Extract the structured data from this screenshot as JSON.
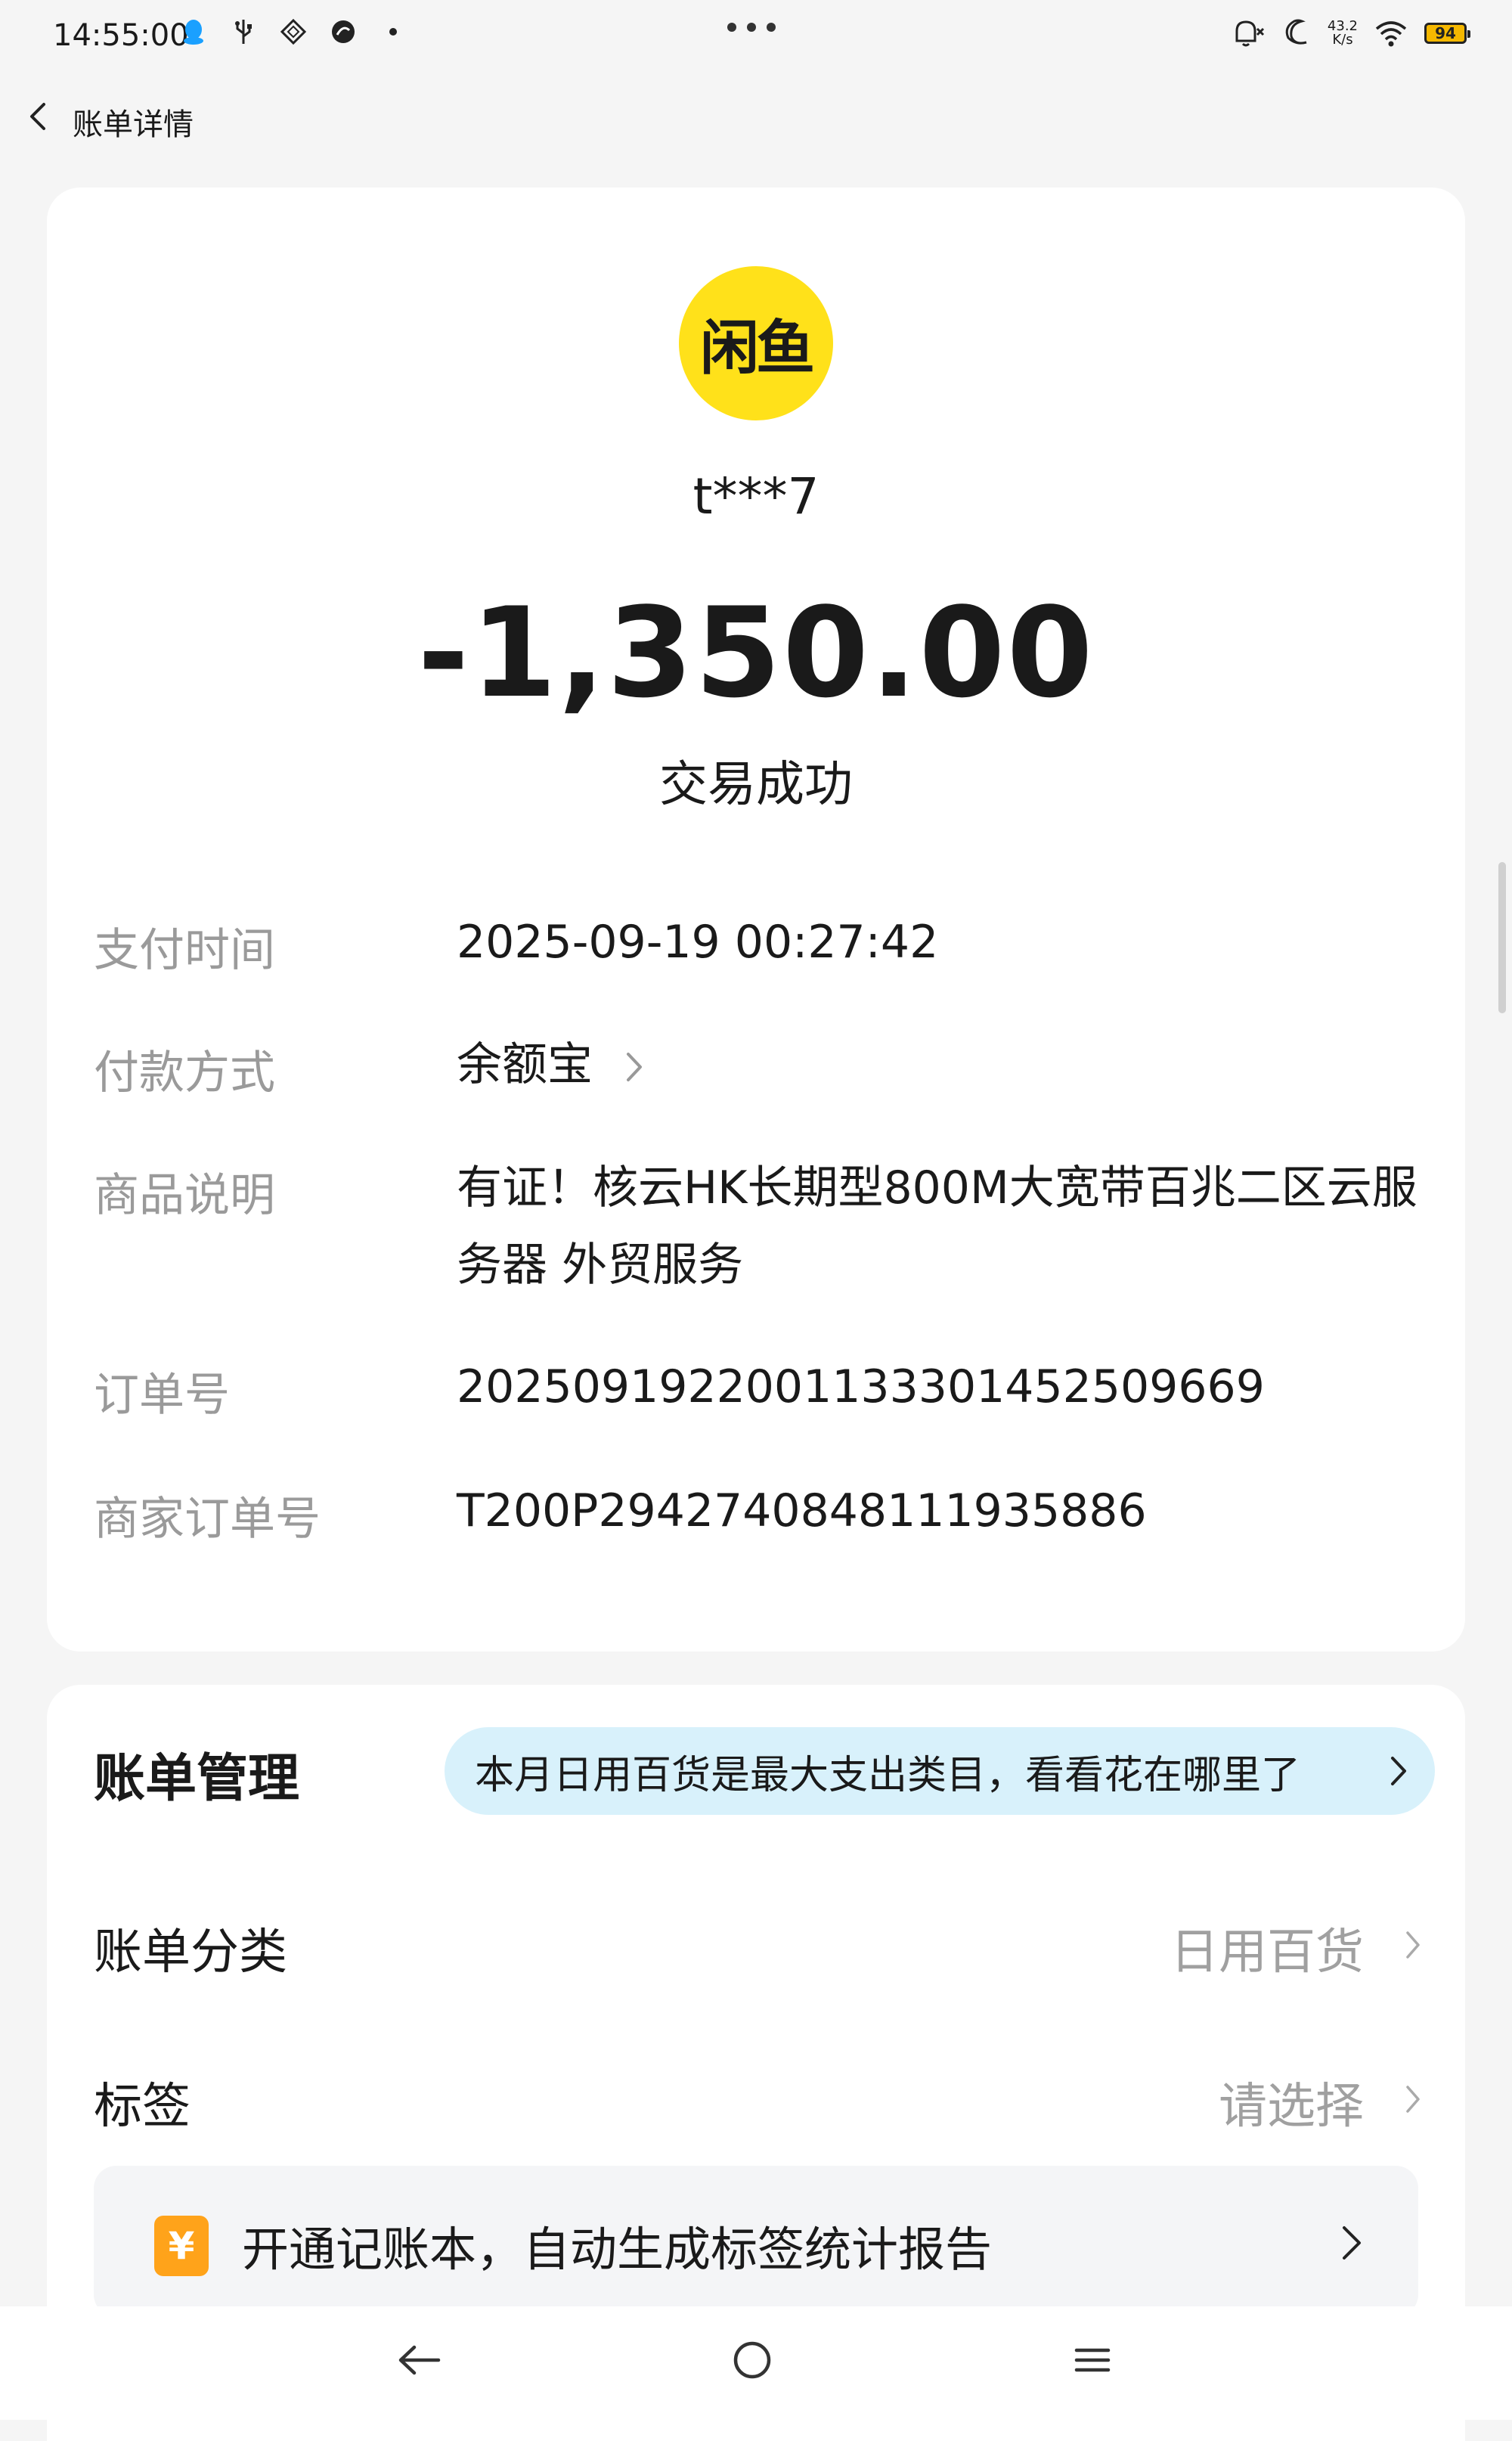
{
  "status_bar": {
    "time": "14:55:00",
    "net_speed_value": "43.2",
    "net_speed_unit": "K/s",
    "battery": "94",
    "icons": [
      "qq-icon",
      "usb-icon",
      "diamond-app-icon",
      "orange-app-icon",
      "dot-icon",
      "mute-bell-icon",
      "moon-icon",
      "wifi-icon",
      "battery-icon"
    ]
  },
  "header": {
    "title": "账单详情"
  },
  "transaction": {
    "logo_text": "闲鱼",
    "merchant": "t***7",
    "amount": "-1,350.00",
    "status": "交易成功",
    "details": [
      {
        "label": "支付时间",
        "value": "2025-09-19 00:27:42"
      },
      {
        "label": "付款方式",
        "value": "余额宝"
      },
      {
        "label": "商品说明",
        "value": "有证！核云HK长期型800M大宽带百兆二区云服务器 外贸服务"
      },
      {
        "label": "订单号",
        "value": "2025091922001133301452509669"
      },
      {
        "label": "商家订单号",
        "value": "T200P2942740848111935886"
      }
    ]
  },
  "management": {
    "title": "账单管理",
    "tip": "本月日用百货是最大支出类目，看看花在哪里了",
    "category_label": "账单分类",
    "category_value": "日用百货",
    "tag_label": "标签",
    "tag_value": "请选择",
    "promo_icon": "¥",
    "promo_text": "开通记账本，自动生成标签统计报告"
  },
  "colors": {
    "background": "#f5f5f5",
    "card": "#ffffff",
    "logo_yellow": "#ffe11a",
    "tip_bg": "#d8f1fb",
    "promo_icon": "#ffa31a",
    "muted_text": "#9a9a9a"
  }
}
